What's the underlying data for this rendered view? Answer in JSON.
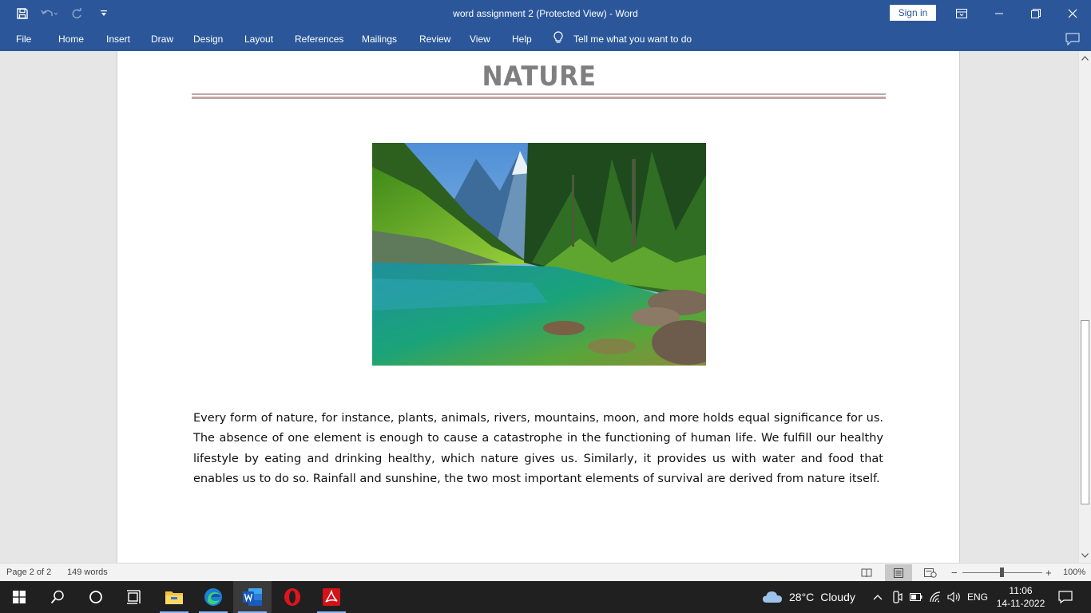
{
  "titlebar": {
    "document_title": "word assignment 2 (Protected View)  -  Word",
    "sign_in_label": "Sign in",
    "qat_icons": [
      "save-icon",
      "undo-icon",
      "redo-icon",
      "customize-qat-icon"
    ],
    "window_icons": [
      "ribbon-display-options-icon",
      "minimize-icon",
      "restore-icon",
      "close-icon"
    ]
  },
  "ribbon": {
    "tabs": [
      {
        "label": "File"
      },
      {
        "label": "Home"
      },
      {
        "label": "Insert"
      },
      {
        "label": "Draw"
      },
      {
        "label": "Design"
      },
      {
        "label": "Layout"
      },
      {
        "label": "References"
      },
      {
        "label": "Mailings"
      },
      {
        "label": "Review"
      },
      {
        "label": "View"
      },
      {
        "label": "Help"
      }
    ],
    "tell_me_label": "Tell me what you want to do",
    "tell_me_icon": "lightbulb-icon",
    "comments_icon": "comment-icon"
  },
  "document": {
    "heading": "NATURE",
    "image_subject": "mountain-lake-forest-photo",
    "paragraph": "Every form of nature, for instance, plants, animals, rivers, mountains, moon, and more holds equal significance for us. The absence of one element is enough to cause a catastrophe in the functioning of human life. We fulfill our healthy lifestyle by eating and drinking healthy, which nature gives us. Similarly, it provides us with water and food that enables us to do so. Rainfall and sunshine, the two most important elements of survival are derived from nature itself."
  },
  "scrollbar": {
    "icons": [
      "scroll-up-icon",
      "scroll-down-icon"
    ]
  },
  "statusbar": {
    "page_info": "Page 2 of 2",
    "word_count": "149 words",
    "view_icons": [
      "read-mode-icon",
      "print-layout-icon",
      "web-layout-icon"
    ],
    "active_view": "print-layout-icon",
    "zoom_out": "−",
    "zoom_in": "+",
    "zoom_level": "100%"
  },
  "taskbar": {
    "apps": [
      {
        "name": "windows-start-icon"
      },
      {
        "name": "search-icon"
      },
      {
        "name": "cortana-icon"
      },
      {
        "name": "task-view-icon"
      },
      {
        "name": "file-explorer-icon"
      },
      {
        "name": "edge-icon"
      },
      {
        "name": "word-icon",
        "active": true
      },
      {
        "name": "opera-icon"
      },
      {
        "name": "acrobat-icon"
      }
    ],
    "weather": {
      "temperature": "28°C",
      "condition": "Cloudy",
      "icon": "cloud-icon"
    },
    "tray_icons": [
      "chevron-up-icon",
      "meet-now-icon",
      "battery-icon",
      "wifi-icon",
      "volume-icon"
    ],
    "language": "ENG",
    "time": "11:06",
    "date": "14-11-2022",
    "notification_icon": "notification-icon",
    "colors": {
      "taskbar_bg": "#202020",
      "word_blue": "#2b579a"
    }
  }
}
